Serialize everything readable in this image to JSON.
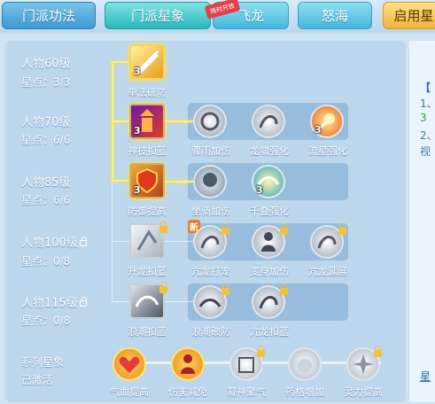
{
  "tabs": [
    {
      "label": "门派功法"
    },
    {
      "label": "门派星象"
    },
    {
      "label": "飞龙"
    },
    {
      "label": "怒海"
    },
    {
      "label": "启用星"
    }
  ],
  "tab_badge": "限时开放",
  "levels": [
    {
      "label": "人物60级",
      "stars": "星点：3/3"
    },
    {
      "label": "人物70级",
      "stars": "星点：6/6"
    },
    {
      "label": "人物85级",
      "stars": "星点：6/6"
    },
    {
      "label": "人物100级",
      "stars": "星点：0/8"
    },
    {
      "label": "人物115级",
      "stars": "星点：0/8"
    }
  ],
  "series": {
    "label": "系列星象",
    "status": "已激活"
  },
  "nodes": [
    {
      "label": "单法破防",
      "num": "3"
    },
    {
      "label": "神技扣蓝",
      "num": "3"
    },
    {
      "label": "骤雨加伤",
      "num": ""
    },
    {
      "label": "龙啸强化",
      "num": ""
    },
    {
      "label": "流星强化",
      "num": "3"
    },
    {
      "label": "防御提高",
      "num": "3"
    },
    {
      "label": "坐骑加伤",
      "num": ""
    },
    {
      "label": "千叠强化",
      "num": "3"
    },
    {
      "label": "升龙扣蓝",
      "num": ""
    },
    {
      "label": "亢龙打宠",
      "num": ""
    },
    {
      "label": "变身加伤",
      "num": ""
    },
    {
      "label": "亢龙延展",
      "num": ""
    },
    {
      "label": "浪潮扣蓝",
      "num": ""
    },
    {
      "label": "浪潮破防",
      "num": ""
    },
    {
      "label": "亢龙扣蓝",
      "num": ""
    }
  ],
  "new_tag": "新",
  "series_nodes": [
    {
      "label": "气血提高"
    },
    {
      "label": "伤害减免"
    },
    {
      "label": "凝神聚气"
    },
    {
      "label": "药格增加"
    },
    {
      "label": "灵力提高"
    }
  ],
  "right_panel": {
    "l1": "【",
    "l2": "1、",
    "l3": "3",
    "l4": "2、",
    "l5": "视",
    "l6": "星"
  }
}
